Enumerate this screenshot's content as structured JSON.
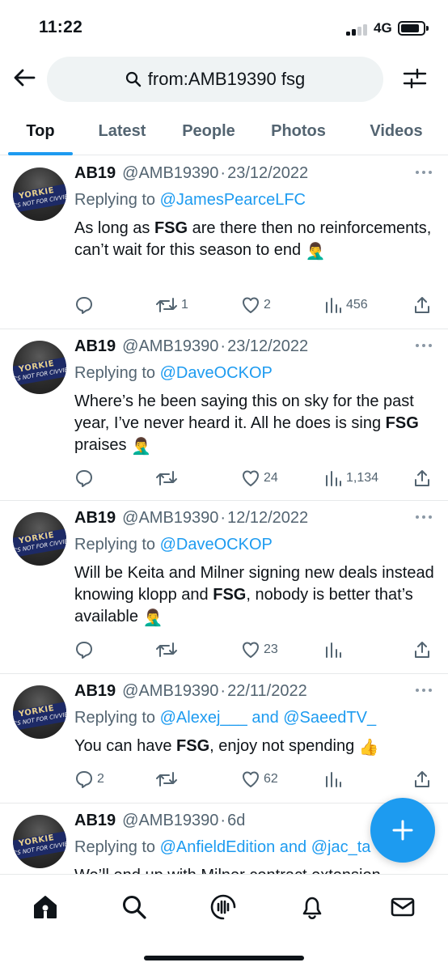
{
  "status_bar": {
    "time": "11:22",
    "network": "4G"
  },
  "search": {
    "query": "from:AMB19390 fsg"
  },
  "tabs": [
    {
      "label": "Top",
      "active": true
    },
    {
      "label": "Latest",
      "active": false
    },
    {
      "label": "People",
      "active": false
    },
    {
      "label": "Photos",
      "active": false
    },
    {
      "label": "Videos",
      "active": false
    }
  ],
  "avatar_text": {
    "top": "YORKIE",
    "bottom": "IT'S NOT FOR CIVVIES"
  },
  "tweets": [
    {
      "name": "AB19",
      "handle": "@AMB19390",
      "date": "23/12/2022",
      "reply_prefix": "Replying to",
      "reply_to": "@JamesPearceLFC",
      "text_parts": [
        "As long as ",
        "FSG",
        " are there then no reinforcements, can’t wait for this season to end ",
        "🤦‍♂️"
      ],
      "replies": "",
      "retweets": "1",
      "likes": "2",
      "views": "456"
    },
    {
      "name": "AB19",
      "handle": "@AMB19390",
      "date": "23/12/2022",
      "reply_prefix": "Replying to",
      "reply_to": "@DaveOCKOP",
      "text_parts": [
        "Where’s he been saying this on sky for the past year, I’ve never heard it. All he does is sing ",
        "FSG",
        " praises ",
        "🤦‍♂️"
      ],
      "replies": "",
      "retweets": "",
      "likes": "24",
      "views": "1,134"
    },
    {
      "name": "AB19",
      "handle": "@AMB19390",
      "date": "12/12/2022",
      "reply_prefix": "Replying to",
      "reply_to": "@DaveOCKOP",
      "text_parts": [
        "Will be Keita and Milner signing new deals instead knowing klopp and ",
        "FSG",
        ", nobody is better that’s available ",
        "🤦‍♂️"
      ],
      "replies": "",
      "retweets": "",
      "likes": "23",
      "views": ""
    },
    {
      "name": "AB19",
      "handle": "@AMB19390",
      "date": "22/11/2022",
      "reply_prefix": "Replying to",
      "reply_to": "@Alexej___ and @SaeedTV_",
      "text_parts": [
        "You can have ",
        "FSG",
        ", enjoy not spending ",
        "👍"
      ],
      "replies": "2",
      "retweets": "",
      "likes": "62",
      "views": ""
    },
    {
      "name": "AB19",
      "handle": "@AMB19390",
      "date": "6d",
      "reply_prefix": "Replying to",
      "reply_to": "@AnfieldEdition and @jac_ta",
      "text_parts": [
        "We’ll end up with Milner contract extension",
        "",
        "",
        ""
      ],
      "replies": "",
      "retweets": "",
      "likes": "",
      "views": ""
    }
  ],
  "colors": {
    "accent": "#1d9bf0",
    "text": "#0f1419",
    "muted": "#536471",
    "divider": "#e7e9ea"
  },
  "icons": {
    "back": "arrow-left-icon",
    "search": "search-icon",
    "filter": "sliders-icon",
    "more": "more-dots-icon",
    "reply": "reply-icon",
    "retweet": "retweet-icon",
    "like": "heart-icon",
    "views": "views-icon",
    "share": "share-icon",
    "compose": "plus-icon",
    "nav": [
      "home-icon",
      "search-icon",
      "spaces-icon",
      "bell-icon",
      "mail-icon"
    ]
  }
}
